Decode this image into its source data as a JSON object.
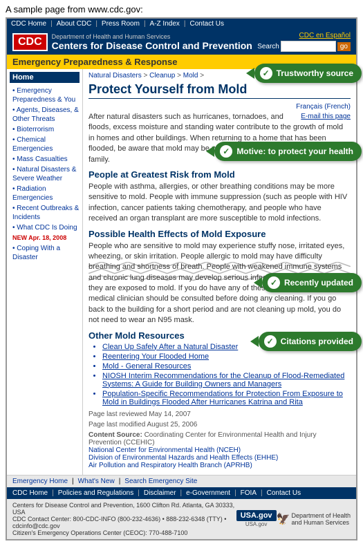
{
  "outer_label": "A sample page from www.cdc.gov:",
  "topnav": {
    "links": [
      "CDC Home",
      "About CDC",
      "Press Room",
      "A-Z Index",
      "Contact Us"
    ]
  },
  "header": {
    "logo": "CDC",
    "dept": "Department of Health and Human Services",
    "title": "Centers for Disease Control and Prevention",
    "en_espanol": "CDC en Español",
    "search_label": "Search",
    "go_label": "go"
  },
  "emergency_bar": "Emergency Preparedness & Response",
  "sidebar": {
    "home_label": "Home",
    "items": [
      "Emergency Preparedness & You",
      "Agents, Diseases, & Other Threats",
      "Bioterrorism",
      "Chemical Emergencies",
      "Mass Casualties",
      "Natural Disasters & Severe Weather",
      "Radiation Emergencies",
      "Recent Outbreaks & Incidents",
      "What CDC Is Doing"
    ],
    "new_label": "NEW Apr. 18, 2008",
    "new_item": "Coping With a Disaster"
  },
  "content": {
    "breadcrumb": "Natural Disasters > Cleanup > Mold >",
    "page_title": "Protect Yourself from Mold",
    "email_link": "E-mail this page",
    "intro_text": "After natural disasters such as hurricanes, tornadoes, and floods, excess moisture and standing water contribute to the growth of mold in homes and other buildings. When returning to a home that has been flooded, be aware that mold may be present and may be a health risk for your family.",
    "section1_heading": "People at Greatest Risk from Mold",
    "section1_text": "People with asthma, allergies, or other breathing conditions may be more sensitive to mold. People with immune suppression (such as people with HIV infection, cancer patients taking chemotherapy, and people who have received an organ transplant are more susceptible to mold infections.",
    "section2_heading": "Possible Health Effects of Mold Exposure",
    "section2_text": "People who are sensitive to mold may experience stuffy nose, irritated eyes, wheezing, or skin irritation. People allergic to mold may have difficulty breathing and shortness of breath. People with weakened immune systems and chronic lung diseases may develop serious infections in their lungs when they are exposed to mold. If you do have any of these conditions, a qualified medical clinician should be consulted before doing any cleaning. If you go back to the building for a short period and are not cleaning up mold, you do not need to wear an N95 mask.",
    "section3_heading": "Other Mold Resources",
    "mold_resources": [
      "Clean Up Safely After a Natural Disaster",
      "Reentering Your Flooded Home",
      "Mold - General Resources",
      "NIOSH Interim Recommendations for the Cleanup of Flood-Remediated Systems: A Guide for Building Owners and Managers",
      "Population-Specific Recommendations for Protection From Exposure to Mold in Buildings Flooded After Hurricanes Katrina and Rita"
    ],
    "date_reviewed": "Page last reviewed May 14, 2007",
    "date_modified": "Page last modified August 25, 2006",
    "content_source_label": "Content Source:",
    "content_source_text": "Coordinating Center for Environmental Health and Injury Prevention (CCEHIC)",
    "source_link1": "National Center for Environmental Health (NCEH)",
    "source_link2": "Division of Environmental Hazards and Health Effects (EHHE)",
    "source_link3": "Air Pollution and Respiratory Health Branch (APRHB)",
    "francais": "Français (French)"
  },
  "callouts": {
    "trustworthy": "Trustworthy source",
    "motive": "Motive: to protect your health",
    "recently_updated": "Recently updated",
    "citations": "Citations provided"
  },
  "footer": {
    "top_links": [
      "Emergency Home",
      "What's New",
      "Search Emergency Site"
    ],
    "mid_links": [
      "CDC Home",
      "Policies and Regulations",
      "Disclaimer",
      "e-Government",
      "FOIA",
      "Contact Us"
    ],
    "address": "Centers for Disease Control and Prevention, 1600 Clifton Rd. Atlanta, GA 30333, USA\nCDC Contact Center: 800-CDC-INFO (800-232-4636) • 888-232-6348 (TTY) • cdcinfo@cdc.gov\nCitizen's Emergency Operations Center (CEOC): 770-488-7100"
  }
}
